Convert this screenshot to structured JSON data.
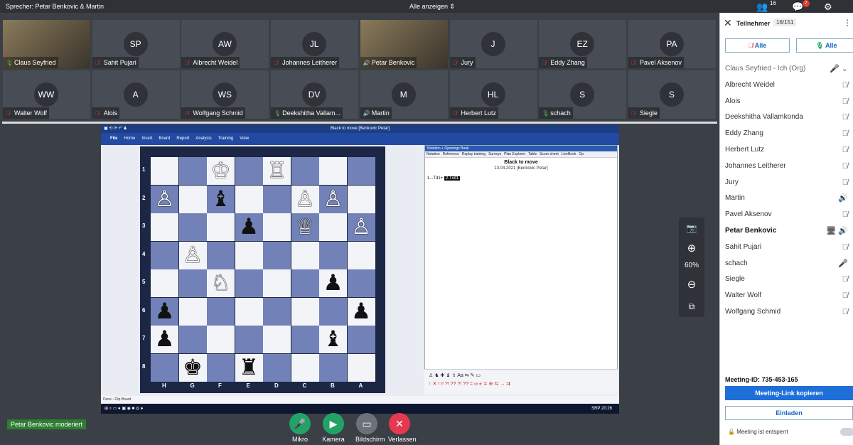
{
  "topbar": {
    "speaker": "Sprecher: Petar Benkovic & Martin",
    "show_all": "Alle anzeigen",
    "participants_count": "16",
    "chat_badge": "7"
  },
  "tiles": [
    {
      "name": "Claus Seyfried",
      "initials": "",
      "mic": "on",
      "video": true
    },
    {
      "name": "Sahit Pujari",
      "initials": "SP",
      "mic": "off"
    },
    {
      "name": "Albrecht Weidel",
      "initials": "AW",
      "mic": "off"
    },
    {
      "name": "Johannes Leitherer",
      "initials": "JL",
      "mic": "off"
    },
    {
      "name": "Petar Benkovic",
      "initials": "",
      "mic": "speaking",
      "video": true
    },
    {
      "name": "Jury",
      "initials": "J",
      "mic": "off"
    },
    {
      "name": "Eddy Zhang",
      "initials": "EZ",
      "mic": "off"
    },
    {
      "name": "Pavel Aksenov",
      "initials": "PA",
      "mic": "off"
    },
    {
      "name": "Walter Wolf",
      "initials": "WW",
      "mic": "off"
    },
    {
      "name": "Alois",
      "initials": "A",
      "mic": "off"
    },
    {
      "name": "Wolfgang Schmid",
      "initials": "WS",
      "mic": "off"
    },
    {
      "name": "Deekshitha Vallam...",
      "initials": "DV",
      "mic": "on"
    },
    {
      "name": "Martin",
      "initials": "M",
      "mic": "speaking"
    },
    {
      "name": "Herbert Lutz",
      "initials": "HL",
      "mic": "off"
    },
    {
      "name": "schach",
      "initials": "S",
      "mic": "on"
    },
    {
      "name": "Siegle",
      "initials": "S",
      "mic": "off"
    }
  ],
  "share": {
    "title": "Black to move  [Benkovic Petar]",
    "menu": [
      "File",
      "Home",
      "Insert",
      "Board",
      "Report",
      "Analysis",
      "Training",
      "View"
    ],
    "ranks": [
      "1",
      "2",
      "3",
      "4",
      "5",
      "6",
      "7",
      "8"
    ],
    "files": [
      "H",
      "G",
      "F",
      "E",
      "D",
      "C",
      "B",
      "A"
    ],
    "pieces": [
      {
        "sq": "f1",
        "p": "♔",
        "c": "w"
      },
      {
        "sq": "d1",
        "p": "♖",
        "c": "w"
      },
      {
        "sq": "h2",
        "p": "♙",
        "c": "w"
      },
      {
        "sq": "f2",
        "p": "♝",
        "c": "b"
      },
      {
        "sq": "c2",
        "p": "♙",
        "c": "w"
      },
      {
        "sq": "b2",
        "p": "♙",
        "c": "w"
      },
      {
        "sq": "e3",
        "p": "♟",
        "c": "b"
      },
      {
        "sq": "c3",
        "p": "♕",
        "c": "w"
      },
      {
        "sq": "a3",
        "p": "♙",
        "c": "w"
      },
      {
        "sq": "g4",
        "p": "♙",
        "c": "w"
      },
      {
        "sq": "f5",
        "p": "♘",
        "c": "w"
      },
      {
        "sq": "b5",
        "p": "♟",
        "c": "b"
      },
      {
        "sq": "h6",
        "p": "♟",
        "c": "b"
      },
      {
        "sq": "a6",
        "p": "♟",
        "c": "b"
      },
      {
        "sq": "h7",
        "p": "♟",
        "c": "b"
      },
      {
        "sq": "b7",
        "p": "♝",
        "c": "b"
      },
      {
        "sq": "g8",
        "p": "♚",
        "c": "b"
      },
      {
        "sq": "e8",
        "p": "♜",
        "c": "b"
      }
    ],
    "notation_header": "Notation + Openings Book",
    "tabs": [
      "Notation",
      "Reference",
      "Replay training",
      "Surveys",
      "Plan Explorer",
      "Table",
      "Score sheet",
      "LiveBook",
      "Op"
    ],
    "status": "Black to move",
    "date": "13.04.2021 [Benkovic Petar]",
    "move1": "1...Td1+",
    "move2": "2.Txd1",
    "status_bar": "Done - Flip Board",
    "tb_lang": "SRP",
    "tb_time": "20:26"
  },
  "zoom": {
    "value": "60%"
  },
  "moderated": "Petar Benkovic moderiert",
  "controls": [
    {
      "label": "Mikro",
      "icon": "🎤",
      "color": "#21a366"
    },
    {
      "label": "Kamera",
      "icon": "▶",
      "color": "#21a366"
    },
    {
      "label": "Bildschirm",
      "icon": "▭",
      "color": "#6d7178"
    },
    {
      "label": "Verlassen",
      "icon": "✕",
      "color": "#e53950"
    }
  ],
  "panel": {
    "title": "Teilnehmer",
    "count": "16/151",
    "mute_all": "Alle",
    "unmute_all": "Alle",
    "people": [
      {
        "name": "Claus Seyfried - Ich (Org)",
        "icon": "🎤  ⌄",
        "cls": "self"
      },
      {
        "name": "Albrecht Weidel",
        "icon": "🎙̸"
      },
      {
        "name": "Alois",
        "icon": "🎙̸"
      },
      {
        "name": "Deekshitha Vallamkonda",
        "icon": "🎙̸"
      },
      {
        "name": "Eddy Zhang",
        "icon": "🎙̸"
      },
      {
        "name": "Herbert Lutz",
        "icon": "🎙̸"
      },
      {
        "name": "Johannes Leitherer",
        "icon": "🎙̸"
      },
      {
        "name": "Jury",
        "icon": "🎙̸"
      },
      {
        "name": "Martin",
        "icon": "🔊"
      },
      {
        "name": "Pavel Aksenov",
        "icon": "🎙̸"
      },
      {
        "name": "Petar Benkovic",
        "icon": "🖥 🔊",
        "cls": "bold"
      },
      {
        "name": "Sahit Pujari",
        "icon": "🎙̸"
      },
      {
        "name": "schach",
        "icon": "🎤"
      },
      {
        "name": "Siegle",
        "icon": "🎙̸"
      },
      {
        "name": "Walter Wolf",
        "icon": "🎙̸"
      },
      {
        "name": "Wolfgang Schmid",
        "icon": "🎙̸"
      }
    ],
    "meeting_id_label": "Meeting-ID:",
    "meeting_id": "735-453-165",
    "copy_link": "Meeting-Link kopieren",
    "invite": "Einladen",
    "lock": "Meeting ist entsperrt"
  }
}
